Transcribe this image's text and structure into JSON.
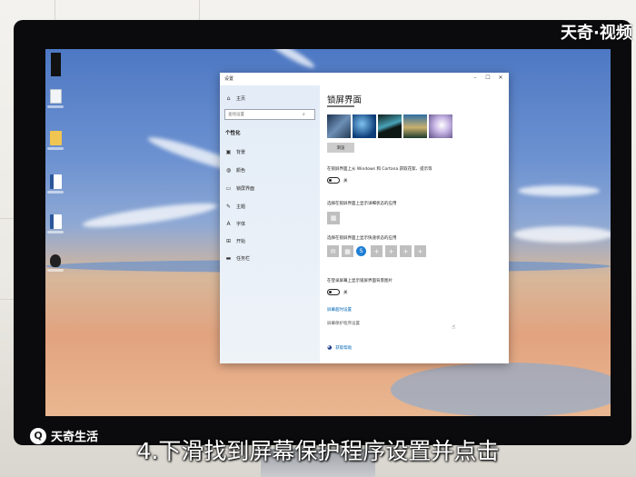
{
  "watermark": {
    "top_right": "天奇·视频",
    "bottom_left": "天奇生活"
  },
  "subtitle": "4.下滑找到屏幕保护程序设置并点击",
  "window": {
    "title": "设置",
    "controls": {
      "minimize": "–",
      "maximize": "☐",
      "close": "✕"
    }
  },
  "sidebar": {
    "home": "主页",
    "search": {
      "placeholder": "查找设置"
    },
    "section": "个性化",
    "items": [
      {
        "label": "背景",
        "icon": "image-icon"
      },
      {
        "label": "颜色",
        "icon": "palette-icon"
      },
      {
        "label": "锁屏界面",
        "icon": "lock-screen-icon"
      },
      {
        "label": "主题",
        "icon": "brush-icon"
      },
      {
        "label": "字体",
        "icon": "font-icon"
      },
      {
        "label": "开始",
        "icon": "start-icon"
      },
      {
        "label": "任务栏",
        "icon": "taskbar-icon"
      }
    ]
  },
  "main": {
    "title": "锁屏界面",
    "browse_button": "浏览",
    "cortana_label": "在锁屏界面上从 Windows 和 Cortana 获取花絮、提示等",
    "cortana_toggle": "关",
    "detailed_app_label": "选择在锁屏界面上显示详细状态的应用",
    "quick_apps_label": "选择在锁屏界面上显示快速状态的应用",
    "quick_apps": [
      "✉",
      "▦",
      "S",
      "+",
      "+",
      "+",
      "+"
    ],
    "signin_bg_label": "在登录屏幕上显示锁屏界面背景图片",
    "signin_bg_toggle": "关",
    "screen_timeout_link": "屏幕超时设置",
    "screensaver_link": "屏幕保护程序设置",
    "help_link": "获取帮助"
  },
  "colors": {
    "accent": "#0067b8",
    "link": "#0067b8"
  }
}
